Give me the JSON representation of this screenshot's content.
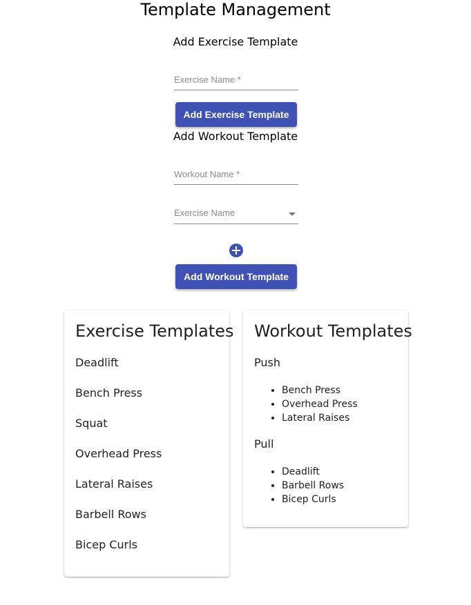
{
  "page_title": "Template Management",
  "exercise_form": {
    "title": "Add Exercise Template",
    "name_placeholder": "Exercise Name *",
    "name_value": "",
    "submit_label": "Add Exercise Template"
  },
  "workout_form": {
    "title": "Add Workout Template",
    "name_placeholder": "Workout Name *",
    "name_value": "",
    "exercise_select_label": "Exercise Name",
    "add_exercise_icon": "add-circle-icon",
    "submit_label": "Add Workout Template"
  },
  "exercise_templates": {
    "title": "Exercise Templates",
    "items": [
      "Deadlift",
      "Bench Press",
      "Squat",
      "Overhead Press",
      "Lateral Raises",
      "Barbell Rows",
      "Bicep Curls"
    ]
  },
  "workout_templates": {
    "title": "Workout Templates",
    "items": [
      {
        "name": "Push",
        "exercises": [
          "Bench Press",
          "Overhead Press",
          "Lateral Raises"
        ]
      },
      {
        "name": "Pull",
        "exercises": [
          "Deadlift",
          "Barbell Rows",
          "Bicep Curls"
        ]
      }
    ]
  },
  "colors": {
    "primary": "#3f51b5",
    "text": "#212121",
    "placeholder": "#8a8a8a"
  }
}
